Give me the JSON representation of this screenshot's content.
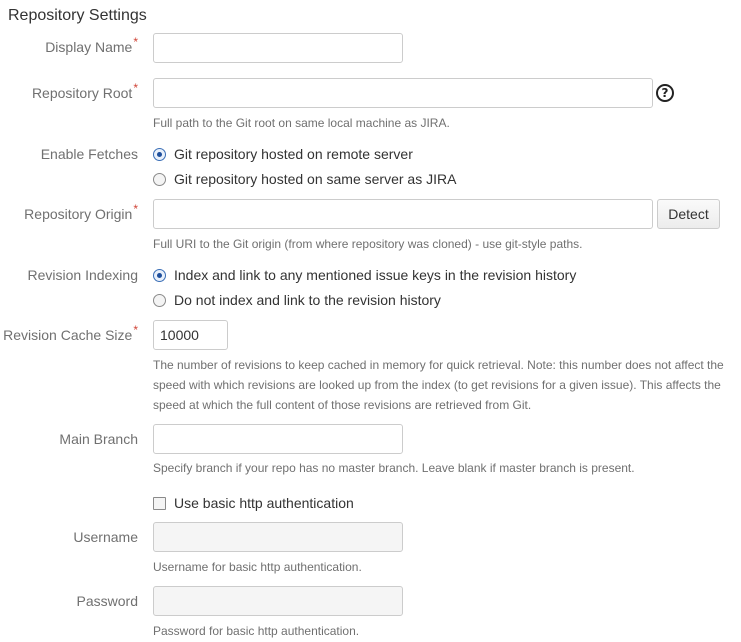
{
  "page": {
    "title": "Repository Settings"
  },
  "fields": {
    "display_name": {
      "label": "Display Name",
      "required": "*",
      "value": ""
    },
    "repository_root": {
      "label": "Repository Root",
      "required": "*",
      "value": "",
      "help_icon": "question-circle-icon",
      "help_glyph": "?",
      "description": "Full path to the Git root on same local machine as JIRA."
    },
    "enable_fetches": {
      "label": "Enable Fetches",
      "options": [
        {
          "label": "Git repository hosted on remote server",
          "checked": true
        },
        {
          "label": "Git repository hosted on same server as JIRA",
          "checked": false
        }
      ]
    },
    "repository_origin": {
      "label": "Repository Origin",
      "required": "*",
      "value": "",
      "detect_label": "Detect",
      "description": "Full URI to the Git origin (from where repository was cloned) - use git-style paths."
    },
    "revision_indexing": {
      "label": "Revision Indexing",
      "options": [
        {
          "label": "Index and link to any mentioned issue keys in the revision history",
          "checked": true
        },
        {
          "label": "Do not index and link to the revision history",
          "checked": false
        }
      ]
    },
    "revision_cache_size": {
      "label": "Revision Cache Size",
      "required": "*",
      "value": "10000",
      "description": "The number of revisions to keep cached in memory for quick retrieval. Note: this number does not affect the speed with which revisions are looked up from the index (to get revisions for a given issue). This affects the speed at which the full content of those revisions are retrieved from Git."
    },
    "main_branch": {
      "label": "Main Branch",
      "value": "",
      "description": "Specify branch if your repo has no master branch. Leave blank if master branch is present."
    },
    "basic_auth": {
      "label": "Use basic http authentication",
      "checked": false
    },
    "username": {
      "label": "Username",
      "value": "",
      "disabled": true,
      "description": "Username for basic http authentication."
    },
    "password": {
      "label": "Password",
      "value": "",
      "disabled": true,
      "description": "Password for basic http authentication."
    }
  },
  "colors": {
    "required_marker": "#d04437",
    "label_text": "#707070",
    "body_text": "#333333",
    "input_border": "#cccccc",
    "disabled_input_bg": "#f5f5f5",
    "radio_checked": "#1e4f9c"
  }
}
